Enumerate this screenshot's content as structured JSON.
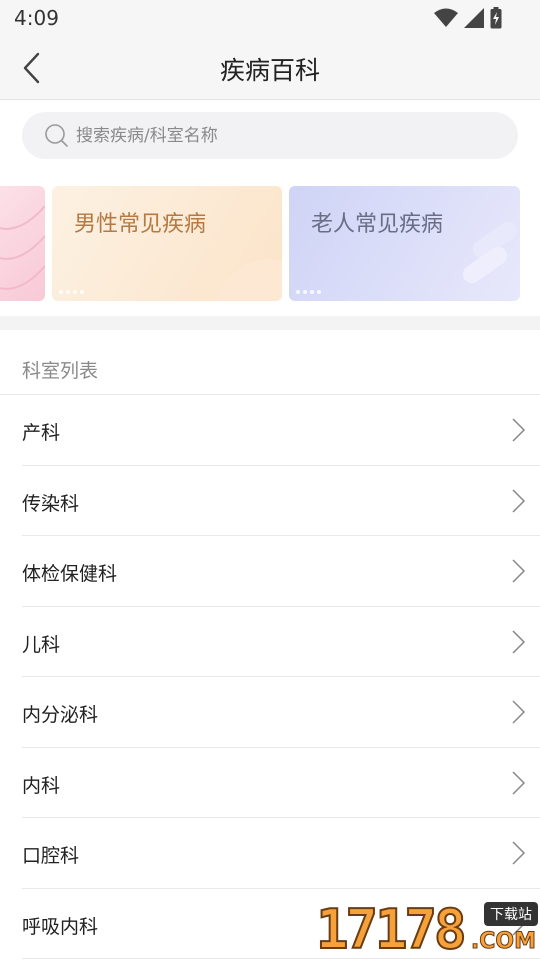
{
  "status": {
    "time": "4:09"
  },
  "header": {
    "title": "疾病百科"
  },
  "search": {
    "placeholder": "搜索疾病/科室名称"
  },
  "banners": [
    {
      "label": "男性常见疾病"
    },
    {
      "label": "老人常见疾病"
    }
  ],
  "section": {
    "title": "科室列表"
  },
  "departments": [
    {
      "label": "产科"
    },
    {
      "label": "传染科"
    },
    {
      "label": "体检保健科"
    },
    {
      "label": "儿科"
    },
    {
      "label": "内分泌科"
    },
    {
      "label": "内科"
    },
    {
      "label": "口腔科"
    },
    {
      "label": "呼吸内科"
    }
  ],
  "watermark": {
    "number": "17178",
    "tag": "下载站",
    "suffix": ".COM"
  },
  "colors": {
    "men_banner": "#fbe4c9",
    "elder_banner": "#cfd4f6",
    "men_text": "#b47a45",
    "elder_text": "#6a6d86"
  },
  "icons": {
    "back": "chevron-left-icon",
    "search": "search-icon",
    "row": "chevron-right-icon"
  }
}
